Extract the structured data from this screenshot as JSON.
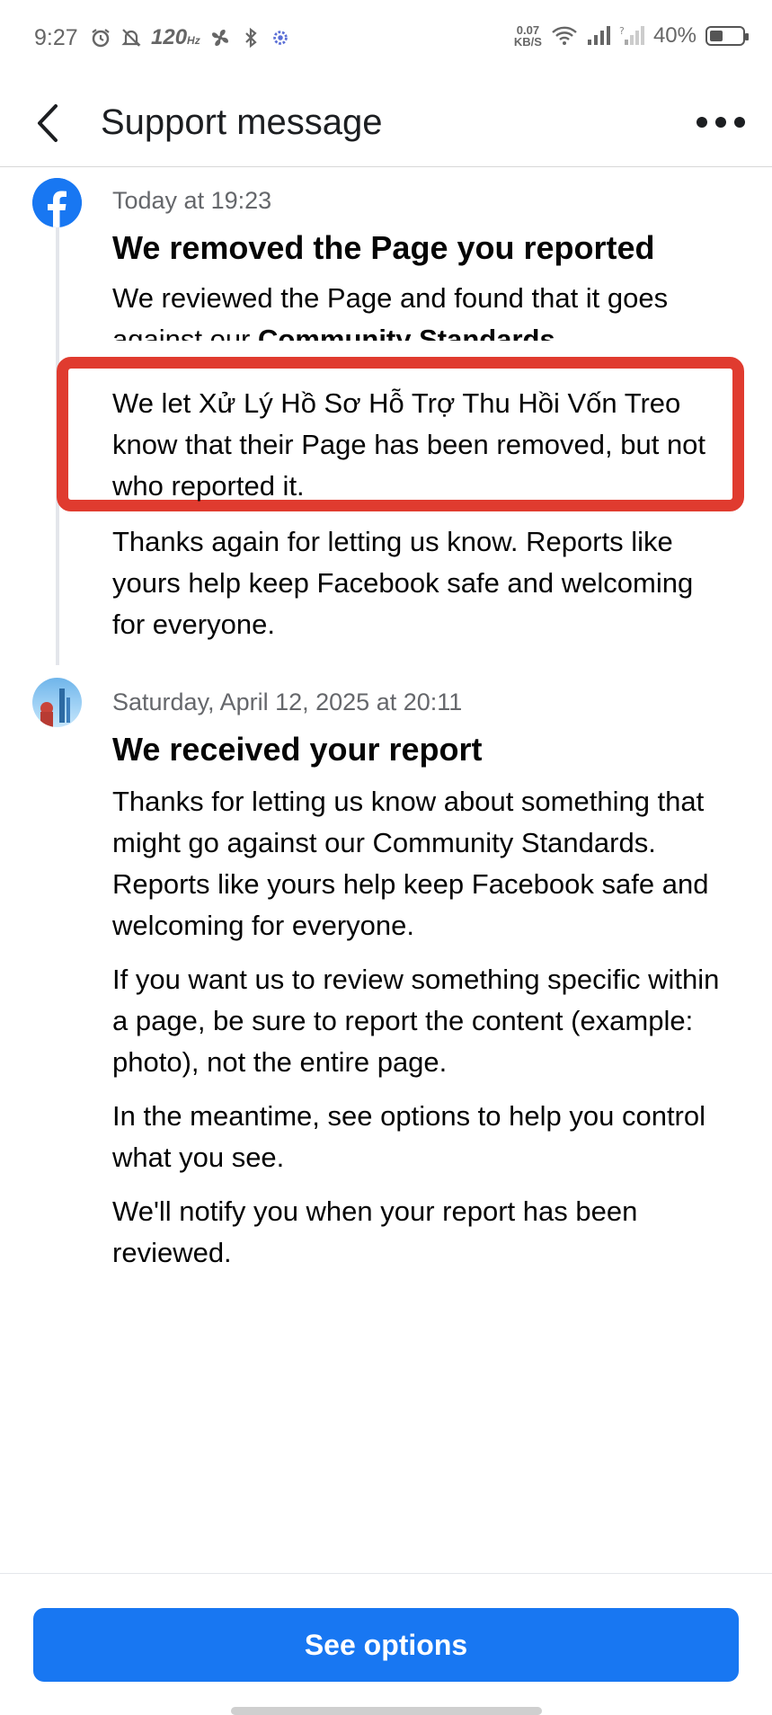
{
  "status_bar": {
    "time": "9:27",
    "refresh_rate": "120",
    "refresh_unit": "Hz",
    "net_speed_value": "0.07",
    "net_speed_unit": "KB/S",
    "battery": "40%",
    "battery_level": 0.4
  },
  "header": {
    "title": "Support message"
  },
  "messages": [
    {
      "timestamp": "Today at 19:23",
      "title": "We removed the Page you reported",
      "para1_plain": "We reviewed the Page and found that it goes against our ",
      "para1_bold": "Community Standards",
      "para1_end": ".",
      "para2": "We let Xử Lý Hồ Sơ Hỗ Trợ Thu Hồi Vốn Treo know that their Page has been removed, but not who reported it.",
      "para3": "Thanks again for letting us know. Reports like yours help keep Facebook safe and welcoming for everyone."
    },
    {
      "timestamp": "Saturday, April 12, 2025 at 20:11",
      "title": "We received your report",
      "para1": "Thanks for letting us know about something that might go against our Community Standards. Reports like yours help keep Facebook safe and welcoming for everyone.",
      "para2": "If you want us to review something specific within a page, be sure to report the content (example: photo), not the entire page.",
      "para3": "In the meantime, see options to help you control what you see.",
      "para4": "We'll notify you when your report has been reviewed."
    }
  ],
  "footer": {
    "button_label": "See options"
  },
  "colors": {
    "brand_blue": "#1877f2",
    "highlight_red": "#e03b2f"
  },
  "icons": {
    "back": "chevron-left-icon",
    "more": "more-horizontal-icon",
    "facebook": "facebook-logo-icon"
  }
}
